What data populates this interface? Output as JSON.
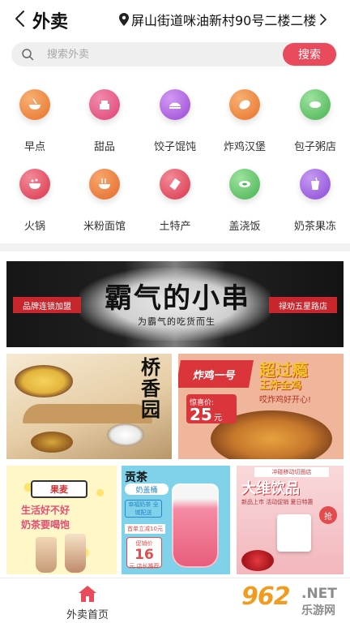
{
  "header": {
    "title": "外卖",
    "address": "屏山街道咪油新村90号二楼二楼"
  },
  "search": {
    "placeholder": "搜索外卖",
    "button_label": "搜索"
  },
  "categories": [
    {
      "label": "早点",
      "icon": "breakfast-bowl-icon",
      "color": "#f08a3c"
    },
    {
      "label": "甜品",
      "icon": "cake-icon",
      "color": "#e85a86"
    },
    {
      "label": "饺子馄饨",
      "icon": "dumpling-icon",
      "color": "#b062e0"
    },
    {
      "label": "炸鸡汉堡",
      "icon": "bread-icon",
      "color": "#f08a3c"
    },
    {
      "label": "包子粥店",
      "icon": "porridge-bowl-icon",
      "color": "#62c46a"
    },
    {
      "label": "火锅",
      "icon": "hotpot-icon",
      "color": "#e4485c"
    },
    {
      "label": "米粉面馆",
      "icon": "noodle-bowl-icon",
      "color": "#f0823c"
    },
    {
      "label": "土特产",
      "icon": "specialty-icon",
      "color": "#e4485c"
    },
    {
      "label": "盖浇饭",
      "icon": "rice-bowl-icon",
      "color": "#5fbf66"
    },
    {
      "label": "奶茶果冻",
      "icon": "milk-tea-icon",
      "color": "#9c5ce0"
    }
  ],
  "banner": {
    "main_text": "霸气的小串",
    "sub_text": "为霸气的吃货而生",
    "left_tag": "品牌连锁加盟",
    "right_tag": "禄劝五星路店"
  },
  "promos": {
    "bridge": {
      "vertical_text": [
        "桥",
        "香",
        "园"
      ]
    },
    "chicken": {
      "tag": "炸鸡一号",
      "headline": "超过瘾",
      "sub1": "王炸全鸡",
      "sub2": "哎炸鸡好开心!",
      "price_label": "惊喜价:",
      "price_value": "25",
      "price_unit": "元"
    },
    "tea": {
      "brand": "果麦",
      "line1": "生活好不好",
      "line2": "奶茶要喝饱"
    },
    "gongcha": {
      "title": "贡茶",
      "sub": "奶盖桶",
      "tag1": "幸福奶茶 全城配送",
      "tag2": "首单立减10元",
      "price_label": "促销价",
      "price_value": "16",
      "price_unit": "元 店长推荐"
    },
    "berry": {
      "top_tag": "冲碰移动切面店",
      "title": "大维饮品",
      "subtitle": "新品上市 活动促销 夏日特惠",
      "badge": "抢"
    }
  },
  "tabbar": {
    "home_label": "外卖首页"
  },
  "watermark": {
    "number": "962",
    "suffix": ".NET",
    "site": "乐游网"
  },
  "colors": {
    "accent": "#e94b5c",
    "home_icon": "#e94b5c"
  }
}
